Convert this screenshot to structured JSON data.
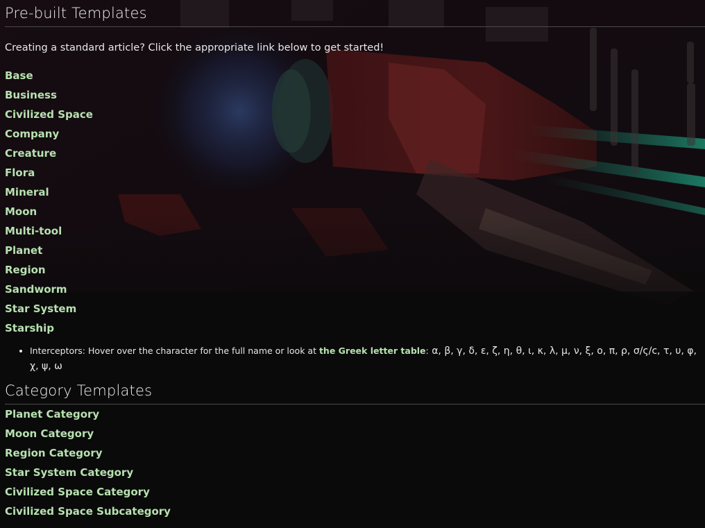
{
  "sections": {
    "prebuilt": {
      "title": "Pre-built Templates",
      "intro": "Creating a standard article? Click the appropriate link below to get started!",
      "links": [
        "Base",
        "Business",
        "Civilized Space",
        "Company",
        "Creature",
        "Flora",
        "Mineral",
        "Moon",
        "Multi-tool",
        "Planet",
        "Region",
        "Sandworm",
        "Star System",
        "Starship"
      ],
      "note": {
        "prefix": "Interceptors: Hover over the character for the full name or look at ",
        "link": "the Greek letter table",
        "colon": ":",
        "letters": " α, β, γ, δ, ε, ζ, η, θ, ι, κ, λ, μ, ν, ξ, ο, π, ρ, σ/ς/c, τ, υ, φ, χ, ψ, ω"
      }
    },
    "category": {
      "title": "Category Templates",
      "links": [
        "Planet Category",
        "Moon Category",
        "Region Category",
        "Star System Category",
        "Civilized Space Category",
        "Civilized Space Subcategory"
      ]
    }
  },
  "colors": {
    "link": "#b7e1b0",
    "background": "#0a0a0a",
    "divider": "#4a4a4a"
  }
}
